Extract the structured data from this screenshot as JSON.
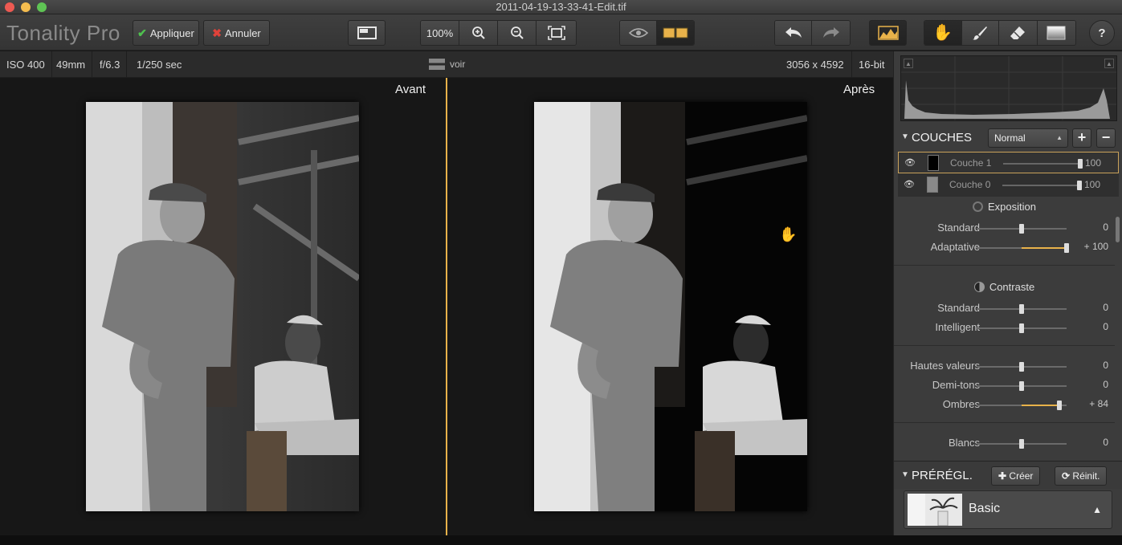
{
  "window": {
    "title": "2011-04-19-13-33-41-Edit.tif"
  },
  "toolbar": {
    "app_name": "Tonality Pro",
    "apply_label": "Appliquer",
    "cancel_label": "Annuler",
    "zoom_label": "100%",
    "accent": "#e8b24a"
  },
  "info": {
    "iso": "ISO 400",
    "focal": "49mm",
    "aperture": "f/6.3",
    "shutter": "1/250 sec",
    "view_label": "voir",
    "dimensions": "3056 x 4592",
    "bitdepth": "16-bit"
  },
  "canvas": {
    "before_label": "Avant",
    "after_label": "Après"
  },
  "layers": {
    "title": "COUCHES",
    "blend_mode": "Normal",
    "items": [
      {
        "name": "Couche 1",
        "opacity": "100",
        "opacity_frac": 1.0
      },
      {
        "name": "Couche 0",
        "opacity": "100",
        "opacity_frac": 1.0
      }
    ]
  },
  "adjustments": {
    "exposure": {
      "title": "Exposition",
      "rows": [
        {
          "label": "Standard",
          "value": "0",
          "pos": 0.5
        },
        {
          "label": "Adaptative",
          "value": "+ 100",
          "pos": 1.0
        }
      ]
    },
    "contrast": {
      "title": "Contraste",
      "rows": [
        {
          "label": "Standard",
          "value": "0",
          "pos": 0.5
        },
        {
          "label": "Intelligent",
          "value": "0",
          "pos": 0.5
        }
      ]
    },
    "tones": {
      "rows": [
        {
          "label": "Hautes valeurs",
          "value": "0",
          "pos": 0.5
        },
        {
          "label": "Demi-tons",
          "value": "0",
          "pos": 0.5
        },
        {
          "label": "Ombres",
          "value": "+ 84",
          "pos": 0.92
        }
      ]
    },
    "whites": {
      "rows": [
        {
          "label": "Blancs",
          "value": "0",
          "pos": 0.5
        }
      ]
    }
  },
  "presets": {
    "title": "PRÉRÉGL.",
    "create_label": "Créer",
    "reset_label": "Réinit.",
    "selected": "Basic"
  }
}
